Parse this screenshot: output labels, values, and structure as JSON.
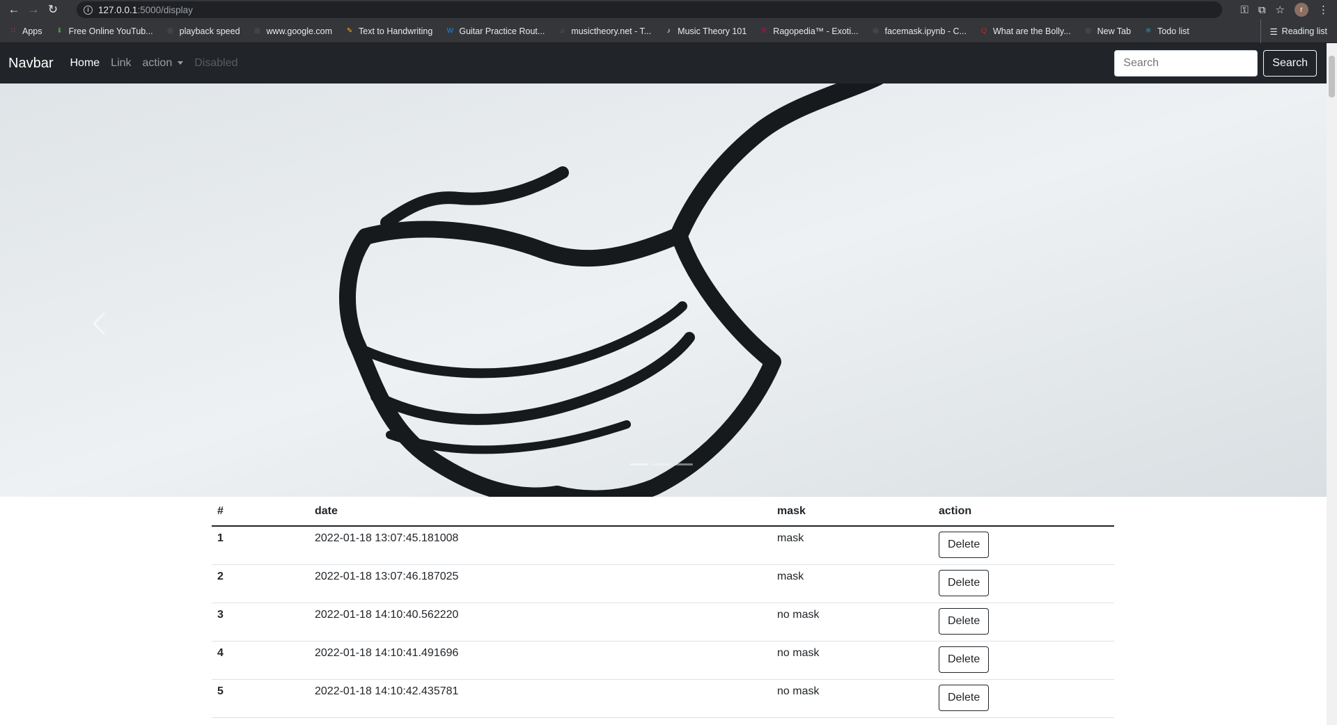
{
  "browser": {
    "url_host": "127.0.0.1",
    "url_path": ":5000/display",
    "profile_initial": "r"
  },
  "bookmarks": [
    {
      "label": "Apps",
      "icon": "apps-grid-icon",
      "color": "#e53935"
    },
    {
      "label": "Free Online YouTub...",
      "icon": "download-arrow-icon",
      "color": "#43a047"
    },
    {
      "label": "playback speed",
      "icon": "globe-icon",
      "color": "#5f6368"
    },
    {
      "label": "www.google.com",
      "icon": "globe-icon",
      "color": "#5f6368"
    },
    {
      "label": "Text to Handwriting",
      "icon": "pen-icon",
      "color": "#f9a825"
    },
    {
      "label": "Guitar Practice Rout...",
      "icon": "wordpress-icon",
      "color": "#1e88e5"
    },
    {
      "label": "musictheory.net - T...",
      "icon": "music-icon",
      "color": "#5f6368"
    },
    {
      "label": "Music Theory 101",
      "icon": "note-icon",
      "color": "#ffffff"
    },
    {
      "label": "Ragopedia™ - Exoti...",
      "icon": "ragopedia-icon",
      "color": "#ad1457"
    },
    {
      "label": "facemask.ipynb - C...",
      "icon": "globe-icon",
      "color": "#5f6368"
    },
    {
      "label": "What are the Bolly...",
      "icon": "quora-icon",
      "color": "#c62828"
    },
    {
      "label": "New Tab",
      "icon": "globe-icon",
      "color": "#5f6368"
    },
    {
      "label": "Todo list",
      "icon": "react-icon",
      "color": "#26c6da"
    }
  ],
  "reading_list_label": "Reading list",
  "navbar": {
    "brand": "Navbar",
    "links": {
      "home": "Home",
      "link": "Link",
      "action": "action",
      "disabled": "Disabled"
    },
    "search_placeholder": "Search",
    "search_button": "Search"
  },
  "table": {
    "headers": {
      "num": "#",
      "date": "date",
      "mask": "mask",
      "action": "action"
    },
    "rows": [
      {
        "num": "1",
        "date": "2022-01-18 13:07:45.181008",
        "mask": "mask",
        "action": "Delete"
      },
      {
        "num": "2",
        "date": "2022-01-18 13:07:46.187025",
        "mask": "mask",
        "action": "Delete"
      },
      {
        "num": "3",
        "date": "2022-01-18 14:10:40.562220",
        "mask": "no mask",
        "action": "Delete"
      },
      {
        "num": "4",
        "date": "2022-01-18 14:10:41.491696",
        "mask": "no mask",
        "action": "Delete"
      },
      {
        "num": "5",
        "date": "2022-01-18 14:10:42.435781",
        "mask": "no mask",
        "action": "Delete"
      }
    ]
  }
}
